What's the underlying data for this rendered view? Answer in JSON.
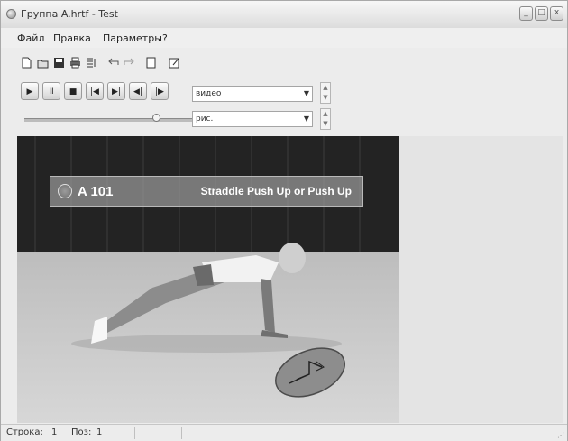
{
  "window": {
    "title": "Группа A.hrtf - Test",
    "buttons": [
      "_",
      "□",
      "x"
    ]
  },
  "menu": {
    "items": [
      "Файл",
      "Правка",
      "Параметры",
      "?"
    ]
  },
  "toolbar": {
    "icons": [
      "new-icon",
      "open-icon",
      "save-icon",
      "print-icon",
      "properties-icon",
      "undo-icon",
      "redo-icon",
      "page-icon",
      "edit-page-icon"
    ]
  },
  "player": {
    "controls": [
      {
        "name": "play",
        "glyph": "▶"
      },
      {
        "name": "pause",
        "glyph": "II"
      },
      {
        "name": "stop",
        "glyph": "■"
      },
      {
        "name": "skip-back",
        "glyph": "|◀"
      },
      {
        "name": "skip-forward",
        "glyph": "▶|"
      },
      {
        "name": "step-back",
        "glyph": "◀|"
      },
      {
        "name": "step-forward",
        "glyph": "|▶"
      }
    ],
    "video_select": "видео",
    "picture_select": "рис.",
    "position": 0.78
  },
  "video": {
    "banner_code": "A 101",
    "banner_title": "Straddle Push Up or Push Up"
  },
  "status": {
    "row_label": "Строка:",
    "row_value": "1",
    "pos_label": "Поз:",
    "pos_value": "1"
  }
}
